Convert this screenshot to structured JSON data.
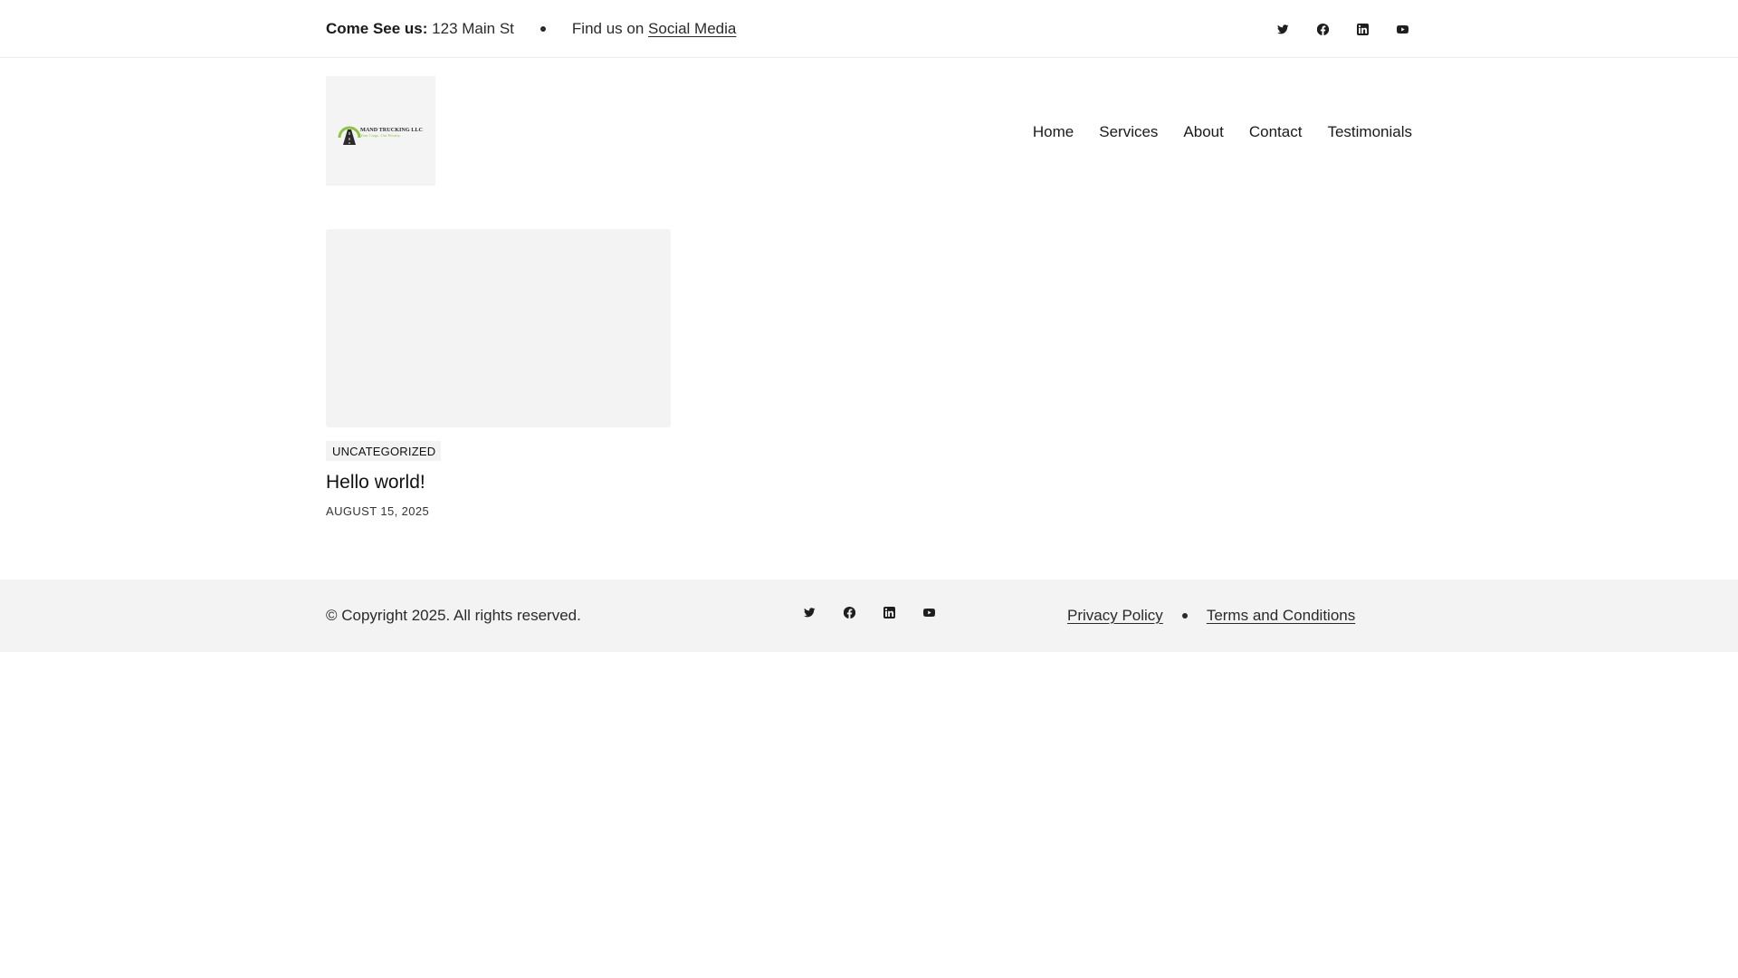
{
  "topbar": {
    "visit_label": "Come See us:",
    "address": "123 Main St",
    "find_text": "Find us on",
    "social_link": "Social Media",
    "social_icons": [
      "twitter-icon",
      "facebook-icon",
      "linkedin-icon",
      "youtube-icon"
    ]
  },
  "header": {
    "logo": {
      "company": "MAND TRUCKING LLC",
      "tagline": "Your Cargo. Our Priority."
    },
    "nav": [
      "Home",
      "Services",
      "About",
      "Contact",
      "Testimonials"
    ]
  },
  "posts": [
    {
      "category": "UNCATEGORIZED",
      "title": "Hello world!",
      "date": "AUGUST 15, 2025"
    }
  ],
  "footer": {
    "copyright": "© Copyright 2025. All rights reserved.",
    "social_icons": [
      "twitter-icon",
      "facebook-icon",
      "linkedin-icon",
      "youtube-icon"
    ],
    "links": [
      "Privacy Policy",
      "Terms and Conditions"
    ]
  },
  "colors": {
    "logo_green": "#8cc63f",
    "logo_dark": "#2b2b2b",
    "panel_gray": "#f3f3f3"
  }
}
